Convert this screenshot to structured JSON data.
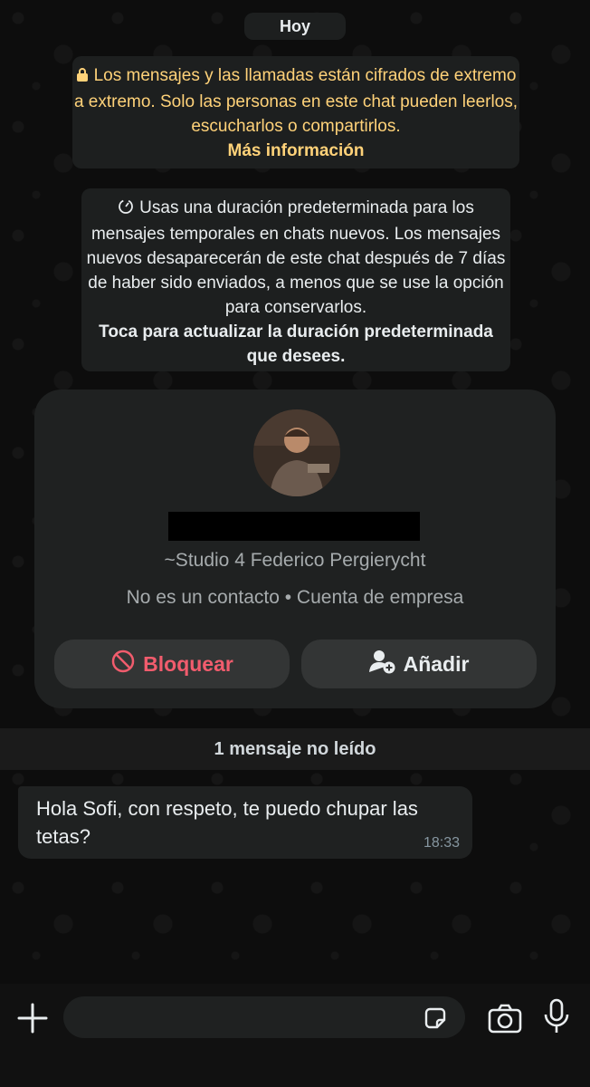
{
  "date_chip": "Hoy",
  "encryption_notice": {
    "text": "Los mensajes y las llamadas están cifrados de extremo a extremo. Solo las personas en este chat pueden leerlos, escucharlos o compartirlos.",
    "link": "Más información",
    "color": "#ffd279",
    "icon": "lock-icon"
  },
  "disappearing_notice": {
    "text": "Usas una duración predeterminada para los mensajes temporales en chats nuevos. Los mensajes nuevos desaparecerán de este chat después de 7 días de haber sido enviados, a menos que se use la opción para conservarlos.",
    "action": "Toca para actualizar la duración predeterminada que desees.",
    "icon": "timer-icon"
  },
  "contact_card": {
    "push_name": "~Studio 4 Federico Pergierycht",
    "meta": "No es un contacto • Cuenta de empresa",
    "block_label": "Bloquear",
    "add_label": "Añadir",
    "block_color": "#f15c6d"
  },
  "unread_label": "1 mensaje no leído",
  "message": {
    "text": "Hola Sofi, con respeto, te puedo chupar las tetas?",
    "time": "18:33"
  },
  "composer": {
    "placeholder": "",
    "icons": [
      "plus-icon",
      "sticker-icon",
      "camera-icon",
      "mic-icon"
    ]
  }
}
